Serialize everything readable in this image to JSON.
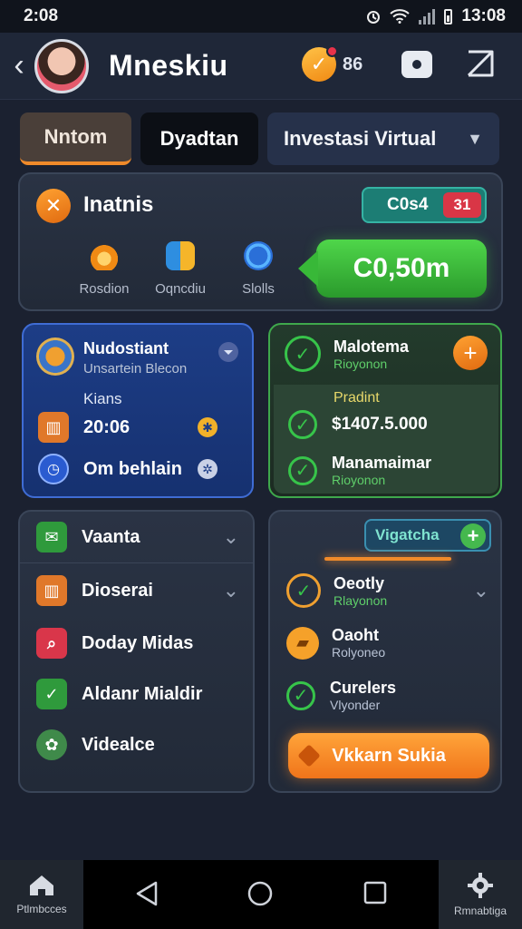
{
  "status": {
    "time": "2:08",
    "clock": "13:08"
  },
  "header": {
    "title": "Mneskiu",
    "notif_count": "86"
  },
  "tabs": [
    {
      "label": "Nntom"
    },
    {
      "label": "Dyadtan"
    },
    {
      "label": "Investasi Virtual"
    }
  ],
  "top_card": {
    "title": "Inatnis",
    "button_label": "C0s4",
    "button_badge": "31",
    "stats": [
      {
        "label": "Rosdion"
      },
      {
        "label": "Oqncdiu"
      },
      {
        "label": "Slolls"
      }
    ],
    "amount": "C0,50m"
  },
  "blue_card": {
    "title": "Nudostiant",
    "subtitle": "Unsartein Blecon",
    "label": "Kians",
    "time": "20:06",
    "action": "Om behlain"
  },
  "green_card": {
    "title": "Malotema",
    "title_sub": "Rioyonon",
    "section": "Pradint",
    "price": "$1407.5.000",
    "item": "Manamaimar",
    "item_sub": "Rioyonon"
  },
  "left_list": {
    "header": "Vaanta",
    "items": [
      {
        "label": "Dioserai"
      },
      {
        "label": "Doday Midas"
      },
      {
        "label": "Aldanr Mialdir"
      },
      {
        "label": "Videalce"
      }
    ]
  },
  "right_list": {
    "pill": "Vigatcha",
    "items": [
      {
        "label": "Oeotly",
        "sub": "Rlayonon"
      },
      {
        "label": "Oaoht",
        "sub": "Rolyoneo"
      },
      {
        "label": "Curelers",
        "sub": "Vlyonder"
      }
    ],
    "cta": "Vkkarn Sukia"
  },
  "nav": {
    "left_label": "Ptlmbcces",
    "right_label": "Rmnabtiga"
  },
  "colors": {
    "accent": "#f08a2a",
    "green": "#37c44a",
    "blue": "#1d3d86",
    "bg": "#1b2130"
  }
}
